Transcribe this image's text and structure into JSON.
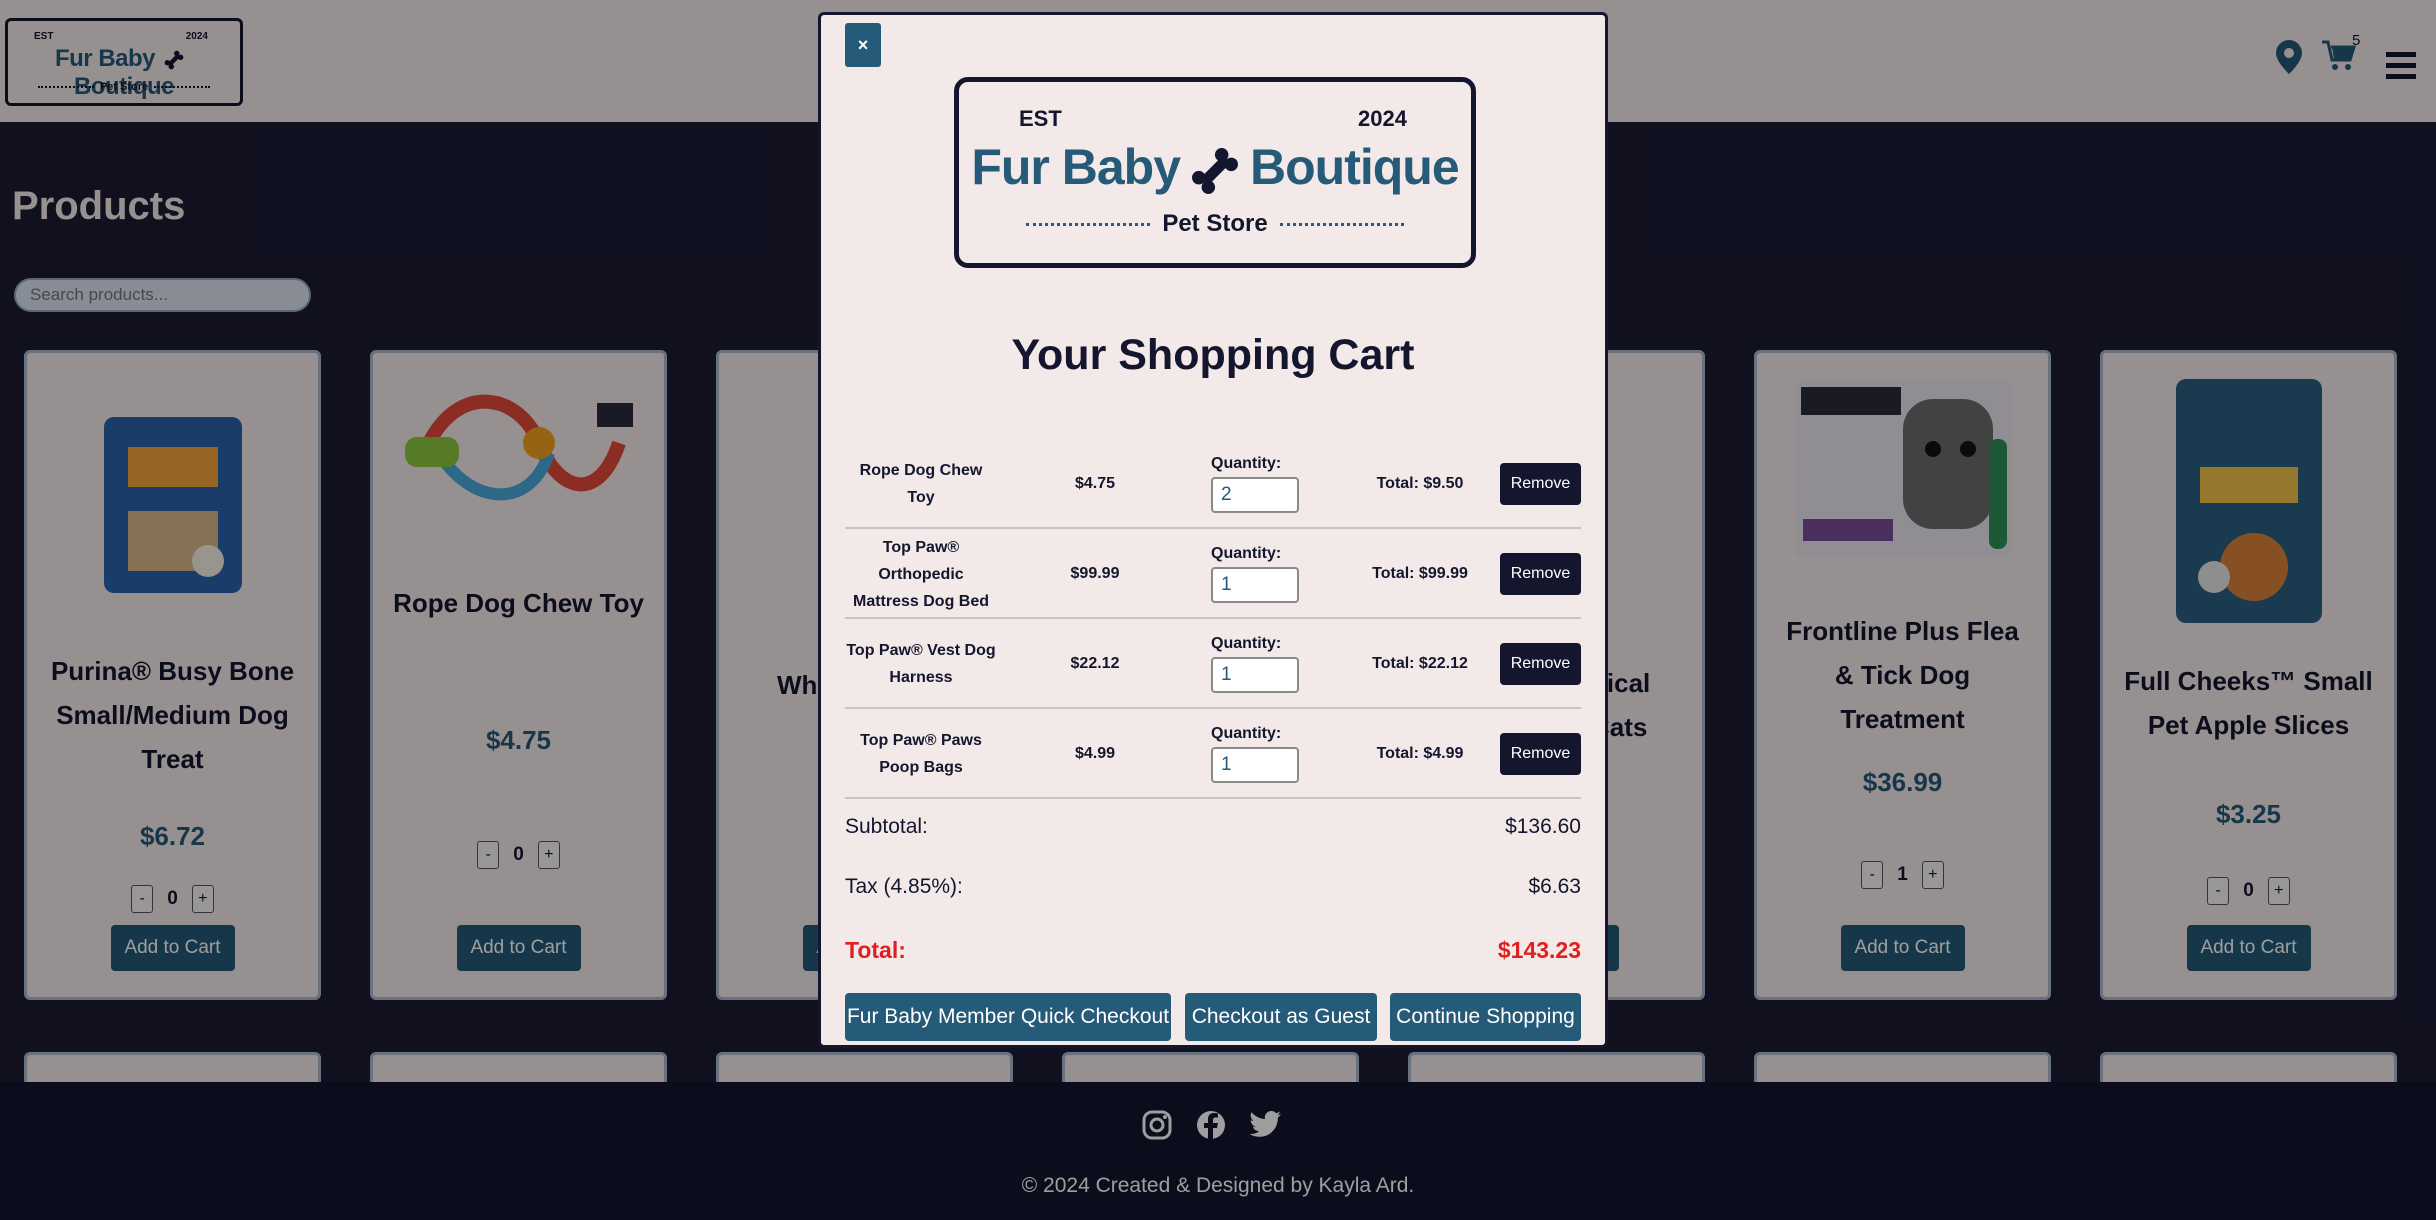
{
  "brand": {
    "est": "EST",
    "year": "2024",
    "name_left": "Fur Baby",
    "name_right": "Boutique",
    "tagline": "Pet Store"
  },
  "header": {
    "cart_count": "5",
    "icons": [
      "location-pin-icon",
      "cart-icon",
      "hamburger-menu-icon"
    ]
  },
  "products_page": {
    "title": "Products",
    "search_placeholder": "Search products...",
    "add_label": "Add to Cart",
    "minus": "-",
    "plus": "+",
    "cards": [
      {
        "name": "Purina® Busy Bone Small/Medium Dog Treat",
        "price": "$6.72",
        "qty": "0"
      },
      {
        "name": "Rope Dog Chew Toy",
        "price": "$4.75",
        "qty": "0"
      },
      {
        "name": "Whi",
        "price": "",
        "qty": ""
      },
      {
        "name": "",
        "price": "",
        "qty": ""
      },
      {
        "name": "pical Cats",
        "price": "",
        "qty": ""
      },
      {
        "name": "Frontline Plus Flea & Tick Dog Treatment",
        "price": "$36.99",
        "qty": "1"
      },
      {
        "name": "Full Cheeks™ Small Pet Apple Slices",
        "price": "$3.25",
        "qty": "0"
      }
    ]
  },
  "cart": {
    "close_label": "×",
    "title": "Your Shopping Cart",
    "quantity_label": "Quantity:",
    "remove_label": "Remove",
    "items": [
      {
        "name": "Rope Dog Chew Toy",
        "price": "$4.75",
        "qty": "2",
        "total": "Total: $9.50"
      },
      {
        "name": "Top Paw® Orthopedic Mattress Dog Bed",
        "price": "$99.99",
        "qty": "1",
        "total": "Total: $99.99"
      },
      {
        "name": "Top Paw® Vest Dog Harness",
        "price": "$22.12",
        "qty": "1",
        "total": "Total: $22.12"
      },
      {
        "name": "Top Paw® Paws Poop Bags",
        "price": "$4.99",
        "qty": "1",
        "total": "Total: $4.99"
      }
    ],
    "subtotal_label": "Subtotal:",
    "subtotal": "$136.60",
    "tax_label": "Tax (4.85%):",
    "tax": "$6.63",
    "total_label": "Total:",
    "total": "$143.23",
    "buttons": {
      "member": "Fur Baby Member Quick Checkout",
      "guest": "Checkout as Guest",
      "continue": "Continue Shopping"
    }
  },
  "footer": {
    "copyright": "© 2024 Created & Designed by Kayla Ard.",
    "social": [
      "instagram-icon",
      "facebook-icon",
      "twitter-icon"
    ]
  },
  "colors": {
    "navy": "#14162e",
    "teal": "#255a78",
    "cream": "#f2e9e8",
    "total_red": "#e02020"
  }
}
